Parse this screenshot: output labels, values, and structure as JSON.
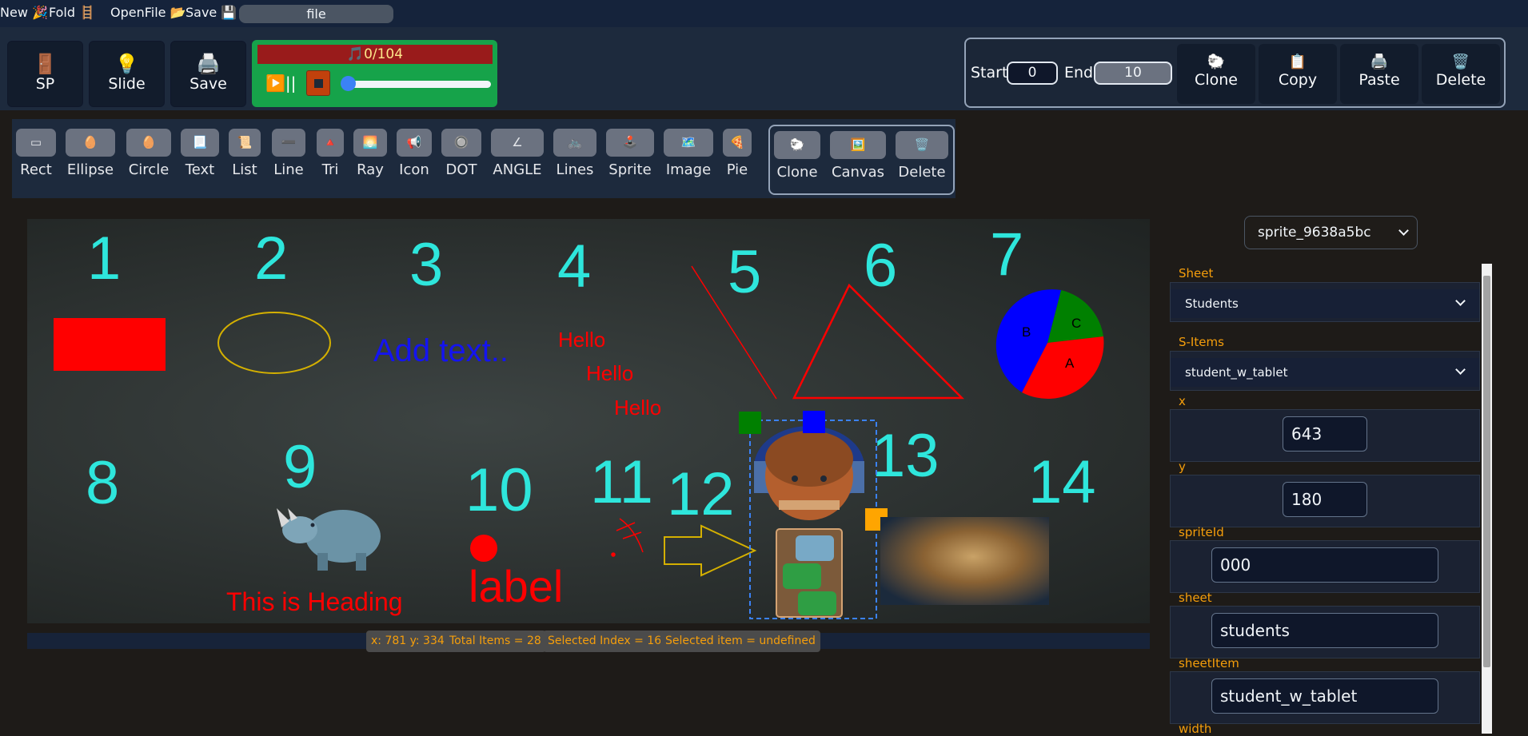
{
  "menu": {
    "new": "New 🎉",
    "fold": "Fold 🪜",
    "openfile": "OpenFile 📂",
    "save": "Save 💾",
    "file_value": "file"
  },
  "toolbar1": {
    "sp": {
      "icon": "🚪",
      "label": "SP"
    },
    "slide": {
      "icon": "💡",
      "label": "Slide"
    },
    "save": {
      "icon": "🖨️",
      "label": "Save"
    }
  },
  "audio": {
    "title": "🎵0/104",
    "play": "▶️||",
    "progress": 0
  },
  "range": {
    "start_label": "Start",
    "start_value": "0",
    "end_label": "End",
    "end_value": "10",
    "buttons": [
      {
        "icon": "🐑",
        "label": "Clone"
      },
      {
        "icon": "📋",
        "label": "Copy"
      },
      {
        "icon": "🖨️",
        "label": "Paste"
      },
      {
        "icon": "🗑️",
        "label": "Delete"
      }
    ]
  },
  "tools": [
    {
      "icon": "▭",
      "label": "Rect"
    },
    {
      "icon": "🥚",
      "label": "Ellipse"
    },
    {
      "icon": "🥚",
      "label": "Circle"
    },
    {
      "icon": "📃",
      "label": "Text"
    },
    {
      "icon": "📜",
      "label": "List"
    },
    {
      "icon": "➖",
      "label": "Line"
    },
    {
      "icon": "🔺",
      "label": "Tri"
    },
    {
      "icon": "🌅",
      "label": "Ray"
    },
    {
      "icon": "📢",
      "label": "Icon"
    },
    {
      "icon": "🔘",
      "label": "DOT"
    },
    {
      "icon": "∠",
      "label": "ANGLE"
    },
    {
      "icon": "🚲",
      "label": "Lines"
    },
    {
      "icon": "🕹️",
      "label": "Sprite"
    },
    {
      "icon": "🗺️",
      "label": "Image"
    },
    {
      "icon": "🍕",
      "label": "Pie"
    }
  ],
  "clone_group": [
    {
      "icon": "🐑",
      "label": "Clone"
    },
    {
      "icon": "🖼️",
      "label": "Canvas"
    },
    {
      "icon": "🗑️",
      "label": "Delete"
    }
  ],
  "canvas": {
    "numbers": [
      "1",
      "2",
      "3",
      "4",
      "5",
      "6",
      "7",
      "8",
      "9",
      "10",
      "11",
      "12",
      "13",
      "14"
    ],
    "add_text": "Add text..",
    "hello": [
      "Hello",
      "Hello",
      "Hello"
    ],
    "heading": "This is Heading",
    "label": "label",
    "pie_labels": [
      "B",
      "C",
      "A"
    ],
    "colors": {
      "number": "#2ee6dc",
      "red": "#ff0000",
      "blue": "#1414f0",
      "yellow": "#d4b000",
      "selection": "#3b82f6"
    }
  },
  "status": {
    "coords": "x: 781 y: 334",
    "total": "Total Items = 28",
    "selected_index": "Selected Index = 16",
    "selected_item": "Selected item = undefined"
  },
  "panel": {
    "sprite_select": "sprite_9638a5bc",
    "sheet_label": "Sheet",
    "sheet_value": "Students",
    "sitems_label": "S-Items",
    "sitems_value": "student_w_tablet",
    "fields": [
      {
        "label": "x",
        "value": "643"
      },
      {
        "label": "y",
        "value": "180"
      },
      {
        "label": "spriteId",
        "value": "000"
      },
      {
        "label": "sheet",
        "value": "students"
      },
      {
        "label": "sheetItem",
        "value": "student_w_tablet"
      },
      {
        "label": "width",
        "value": ""
      }
    ]
  }
}
